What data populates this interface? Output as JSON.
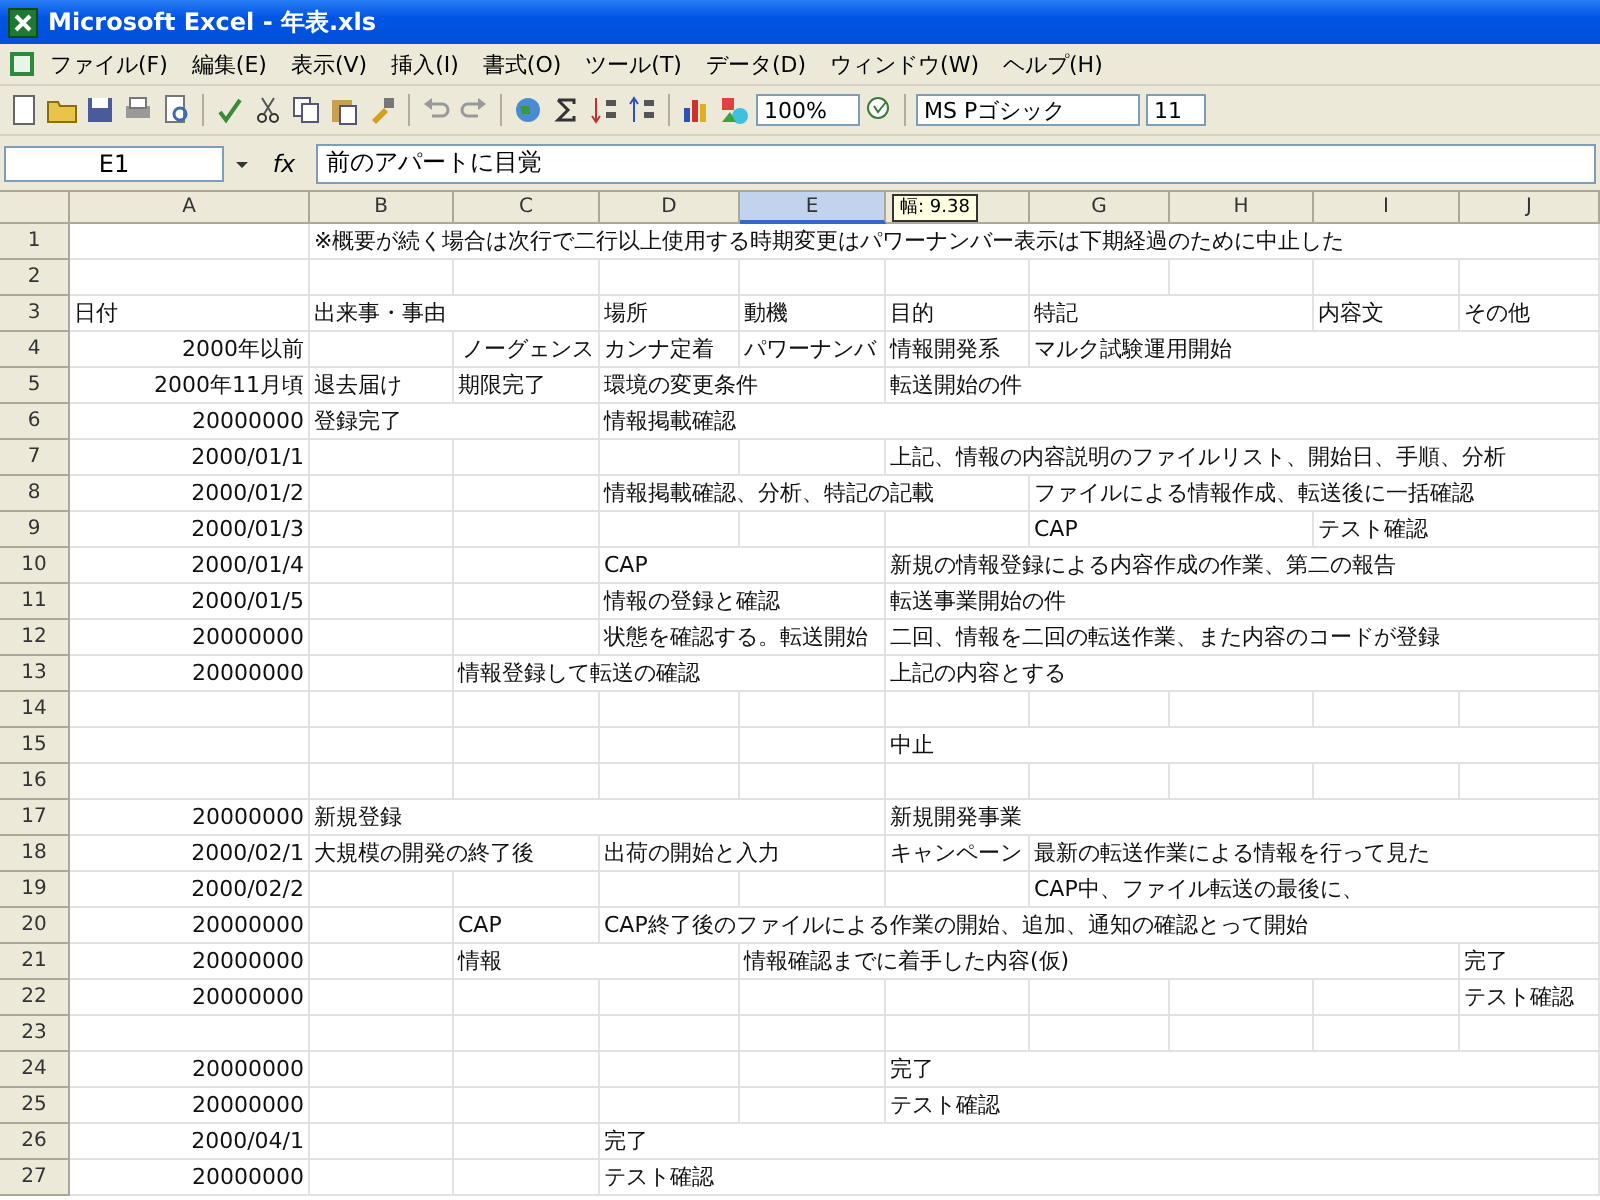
{
  "window": {
    "title": "Microsoft Excel - 年表.xls"
  },
  "menu": [
    "ファイル(F)",
    "編集(E)",
    "表示(V)",
    "挿入(I)",
    "書式(O)",
    "ツール(T)",
    "データ(D)",
    "ウィンドウ(W)",
    "ヘルプ(H)"
  ],
  "toolbar": {
    "zoom": "100%",
    "font": "MS Pゴシック",
    "font_size": "11"
  },
  "formula_bar": {
    "name_box": "E1",
    "fx": "fx",
    "value": "前のアパートに目覚"
  },
  "sheet": {
    "column_tip": "幅: 9.38",
    "columns": [
      {
        "label": "A",
        "selected": false
      },
      {
        "label": "B",
        "selected": false
      },
      {
        "label": "C",
        "selected": false
      },
      {
        "label": "D",
        "selected": false
      },
      {
        "label": "E",
        "selected": true
      },
      {
        "selected": false
      },
      {
        "label": "G",
        "selected": false
      },
      {
        "label": "H",
        "selected": false
      },
      {
        "label": "I",
        "selected": false
      },
      {
        "label": "J",
        "selected": false
      }
    ],
    "rows": [
      {
        "number": "1",
        "cells": {
          "B": "※概要が続く場合は次行で二行以上使用する時期変更はパワーナンバー表示は下期経過のために中止した"
        }
      },
      {
        "number": "2",
        "cells": {}
      },
      {
        "number": "3",
        "cells": {
          "A": "日付",
          "B": "出来事・事由",
          "D": "場所",
          "E": "動機",
          "F": "目的",
          "G": "特記",
          "I": "内容文",
          "J": "その他"
        }
      },
      {
        "number": "4",
        "cells": {
          "A": {
            "text": "2000年以前",
            "kind": "number"
          },
          "C": {
            "text": "ノーグェンス",
            "kind": "number"
          },
          "D": "カンナ定着",
          "E": "パワーナンバ",
          "F": "情報開発系",
          "G": "マルク試験運用開始"
        }
      },
      {
        "number": "5",
        "cells": {
          "A": {
            "text": "2000年11月頃",
            "kind": "number"
          },
          "B": "退去届け",
          "C": "期限完了",
          "D": "環境の変更条件",
          "F": "転送開始の件"
        }
      },
      {
        "number": "6",
        "cells": {
          "A": {
            "text": "20000000",
            "kind": "number"
          },
          "B": "登録完了",
          "D": "情報掲載確認"
        }
      },
      {
        "number": "7",
        "cells": {
          "A": {
            "text": "2000/01/1",
            "kind": "number"
          },
          "F": "上記、情報の内容説明のファイルリスト、開始日、手順、分析"
        }
      },
      {
        "number": "8",
        "cells": {
          "A": {
            "text": "2000/01/2",
            "kind": "number"
          },
          "D": "情報掲載確認、分析、特記の記載",
          "G": "ファイルによる情報作成、転送後に一括確認"
        }
      },
      {
        "number": "9",
        "cells": {
          "A": {
            "text": "2000/01/3",
            "kind": "number"
          },
          "G": "CAP",
          "I": "テスト確認"
        }
      },
      {
        "number": "10",
        "cells": {
          "A": {
            "text": "2000/01/4",
            "kind": "number"
          },
          "D": "CAP",
          "F": "新規の情報登録による内容作成の作業、第二の報告"
        }
      },
      {
        "number": "11",
        "cells": {
          "A": {
            "text": "2000/01/5",
            "kind": "number"
          },
          "D": "情報の登録と確認",
          "F": "転送事業開始の件"
        }
      },
      {
        "number": "12",
        "cells": {
          "A": {
            "text": "20000000",
            "kind": "number"
          },
          "D": "状態を確認する。転送開始",
          "F": "二回、情報を二回の転送作業、また内容のコードが登録"
        }
      },
      {
        "number": "13",
        "cells": {
          "A": {
            "text": "20000000",
            "kind": "number"
          },
          "C": "情報登録して転送の確認",
          "F": "上記の内容とする"
        }
      },
      {
        "number": "14",
        "cells": {}
      },
      {
        "number": "15",
        "cells": {
          "F": "中止"
        }
      },
      {
        "number": "16",
        "cells": {}
      },
      {
        "number": "17",
        "cells": {
          "A": {
            "text": "20000000",
            "kind": "number"
          },
          "B": "新規登録",
          "F": "新規開発事業"
        }
      },
      {
        "number": "18",
        "cells": {
          "A": {
            "text": "2000/02/1",
            "kind": "number"
          },
          "B": "大規模の開発の終了後",
          "D": "出荷の開始と入力",
          "F": "キャンペーン",
          "G": "最新の転送作業による情報を行って見た"
        }
      },
      {
        "number": "19",
        "cells": {
          "A": {
            "text": "2000/02/2",
            "kind": "number"
          },
          "G": "CAP中、ファイル転送の最後に、"
        }
      },
      {
        "number": "20",
        "cells": {
          "A": {
            "text": "20000000",
            "kind": "number"
          },
          "C": "CAP",
          "D": "CAP終了後のファイルによる作業の開始、追加、通知の確認とって開始"
        }
      },
      {
        "number": "21",
        "cells": {
          "A": {
            "text": "20000000",
            "kind": "number"
          },
          "C": "情報",
          "E": "情報確認までに着手した内容(仮)",
          "J": "完了"
        }
      },
      {
        "number": "22",
        "cells": {
          "A": {
            "text": "20000000",
            "kind": "number"
          },
          "J": "テスト確認"
        }
      },
      {
        "number": "23",
        "cells": {}
      },
      {
        "number": "24",
        "cells": {
          "A": {
            "text": "20000000",
            "kind": "number"
          },
          "F": "完了"
        }
      },
      {
        "number": "25",
        "cells": {
          "A": {
            "text": "20000000",
            "kind": "number"
          },
          "F": "テスト確認"
        }
      },
      {
        "number": "26",
        "cells": {
          "A": {
            "text": "2000/04/1",
            "kind": "number"
          },
          "D": "完了"
        }
      },
      {
        "number": "27",
        "cells": {
          "A": {
            "text": "20000000",
            "kind": "number"
          },
          "D": "テスト確認"
        }
      }
    ]
  }
}
